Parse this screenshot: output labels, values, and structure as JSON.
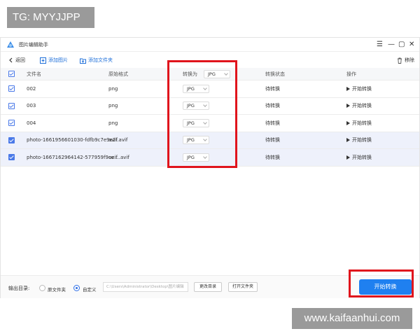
{
  "watermarks": {
    "top": "TG: MYYJJPP",
    "bottom": "www.kaifaanhui.com"
  },
  "app": {
    "title": "图片编辑助手"
  },
  "toolbar": {
    "back": "返回",
    "add_image": "添加图片",
    "add_folder": "添加文件夹",
    "delete": "移除"
  },
  "table": {
    "headers": {
      "name": "文件名",
      "format": "原始格式",
      "convert_to": "转换为",
      "status": "转换状态",
      "action": "操作"
    },
    "header_format_value": "JPG",
    "rows": [
      {
        "name": "002",
        "format": "png",
        "target": "JPG",
        "status": "待转换",
        "action": "开始转换"
      },
      {
        "name": "003",
        "format": "png",
        "target": "JPG",
        "status": "待转换",
        "action": "开始转换"
      },
      {
        "name": "004",
        "format": "png",
        "target": "JPG",
        "status": "待转换",
        "action": "开始转换"
      },
      {
        "name": "photo-1661956601030-fdfb9c7e9e2f.avif",
        "format": "avif",
        "target": "JPG",
        "status": "待转换",
        "action": "开始转换"
      },
      {
        "name": "photo-1667162964142-577959f9ce....avif",
        "format": "avif",
        "target": "JPG",
        "status": "待转换",
        "action": "开始转换"
      }
    ]
  },
  "footer": {
    "output_label": "输出目录:",
    "option_source": "原文件夹",
    "option_custom": "自定义",
    "path_value": "C:\\Users\\Administrator\\Desktop\\图片编辑",
    "change_dir": "更改目录",
    "open_folder": "打开文件夹",
    "start_convert": "开始转换"
  },
  "colors": {
    "accent": "#1f80f0",
    "highlight": "#e0141c",
    "checkbox": "#4a79e8"
  }
}
